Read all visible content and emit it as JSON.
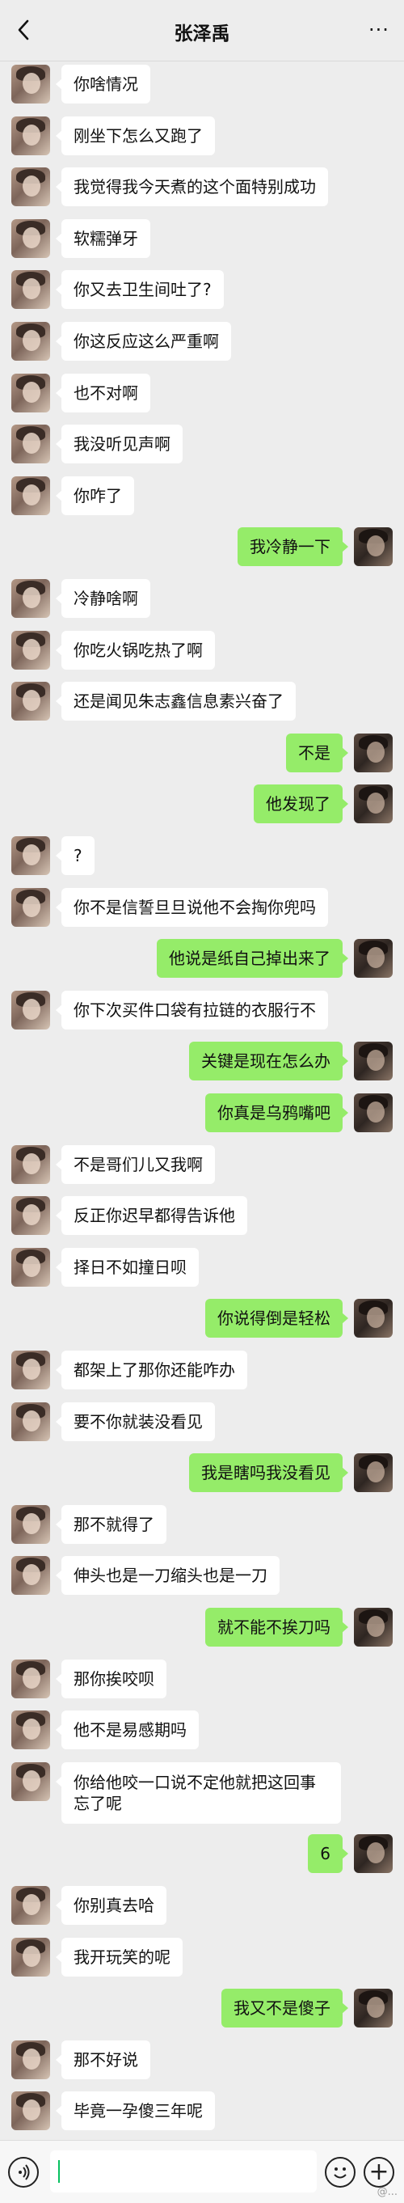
{
  "header": {
    "title": "张泽禹",
    "back_icon": "back-chevron-icon",
    "more_icon": "more-dots-icon",
    "more_label": "···"
  },
  "colors": {
    "background": "#ededed",
    "incoming_bubble": "#ffffff",
    "outgoing_bubble": "#95ec69",
    "caret": "#07c160"
  },
  "messages": [
    {
      "side": "left",
      "text": "你啥情况"
    },
    {
      "side": "left",
      "text": "刚坐下怎么又跑了"
    },
    {
      "side": "left",
      "text": "我觉得我今天煮的这个面特别成功"
    },
    {
      "side": "left",
      "text": "软糯弹牙"
    },
    {
      "side": "left",
      "text": "你又去卫生间吐了?"
    },
    {
      "side": "left",
      "text": "你这反应这么严重啊"
    },
    {
      "side": "left",
      "text": "也不对啊"
    },
    {
      "side": "left",
      "text": "我没听见声啊"
    },
    {
      "side": "left",
      "text": "你咋了"
    },
    {
      "side": "right",
      "text": "我冷静一下"
    },
    {
      "side": "left",
      "text": "冷静啥啊"
    },
    {
      "side": "left",
      "text": "你吃火锅吃热了啊"
    },
    {
      "side": "left",
      "text": "还是闻见朱志鑫信息素兴奋了"
    },
    {
      "side": "right",
      "text": "不是"
    },
    {
      "side": "right",
      "text": "他发现了"
    },
    {
      "side": "left",
      "text": "?"
    },
    {
      "side": "left",
      "text": "你不是信誓旦旦说他不会掏你兜吗"
    },
    {
      "side": "right",
      "text": "他说是纸自己掉出来了"
    },
    {
      "side": "left",
      "text": "你下次买件口袋有拉链的衣服行不"
    },
    {
      "side": "right",
      "text": "关键是现在怎么办"
    },
    {
      "side": "right",
      "text": "你真是乌鸦嘴吧"
    },
    {
      "side": "left",
      "text": "不是哥们儿又我啊"
    },
    {
      "side": "left",
      "text": "反正你迟早都得告诉他"
    },
    {
      "side": "left",
      "text": "择日不如撞日呗"
    },
    {
      "side": "right",
      "text": "你说得倒是轻松"
    },
    {
      "side": "left",
      "text": "都架上了那你还能咋办"
    },
    {
      "side": "left",
      "text": "要不你就装没看见"
    },
    {
      "side": "right",
      "text": "我是瞎吗我没看见"
    },
    {
      "side": "left",
      "text": "那不就得了"
    },
    {
      "side": "left",
      "text": "伸头也是一刀缩头也是一刀"
    },
    {
      "side": "right",
      "text": "就不能不挨刀吗"
    },
    {
      "side": "left",
      "text": "那你挨咬呗"
    },
    {
      "side": "left",
      "text": "他不是易感期吗"
    },
    {
      "side": "left",
      "text": "你给他咬一口说不定他就把这回事忘了呢",
      "tall": true
    },
    {
      "side": "right",
      "text": "6"
    },
    {
      "side": "left",
      "text": "你别真去哈"
    },
    {
      "side": "left",
      "text": "我开玩笑的呢"
    },
    {
      "side": "right",
      "text": "我又不是傻子"
    },
    {
      "side": "left",
      "text": "那不好说"
    },
    {
      "side": "left",
      "text": "毕竟一孕傻三年呢"
    }
  ],
  "input_bar": {
    "voice_icon": "voice-icon",
    "emoji_icon": "emoji-icon",
    "plus_icon": "plus-icon",
    "plus_label": "+",
    "input_value": ""
  },
  "watermark": "@..."
}
